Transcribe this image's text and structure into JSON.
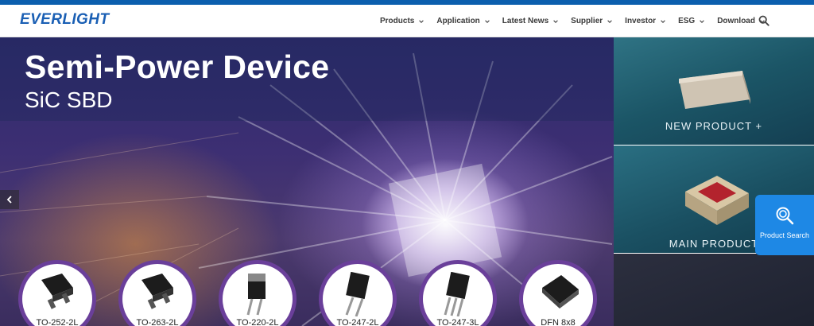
{
  "brand": {
    "name": "EVERLIGHT",
    "accent": "#0b5fae"
  },
  "nav": {
    "items": [
      {
        "label": "Products"
      },
      {
        "label": "Application"
      },
      {
        "label": "Latest News"
      },
      {
        "label": "Supplier"
      },
      {
        "label": "Investor"
      },
      {
        "label": "ESG"
      },
      {
        "label": "Download"
      }
    ],
    "search_icon": "search-icon"
  },
  "hero": {
    "title": "Semi-Power Device",
    "subtitle": "SiC SBD",
    "packages": [
      {
        "label": "TO-252-2L"
      },
      {
        "label": "TO-263-2L"
      },
      {
        "label": "TO-220-2L"
      },
      {
        "label": "TO-247-2L"
      },
      {
        "label": "TO-247-3L"
      },
      {
        "label": "DFN 8x8"
      }
    ]
  },
  "side_panel": {
    "new_product": "NEW PRODUCT +",
    "main_product": "MAIN PRODUCT",
    "product_search": "Product Search"
  }
}
